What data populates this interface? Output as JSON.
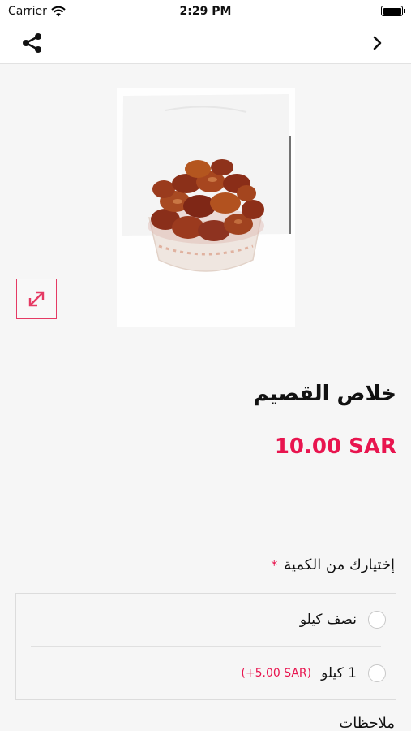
{
  "status_bar": {
    "carrier": "Carrier",
    "time": "2:29 PM"
  },
  "nav": {
    "share_icon": "share-icon",
    "back_icon": "chevron-right-icon"
  },
  "product": {
    "title": "خلاص القصيم",
    "price": "10.00 SAR",
    "zoom_icon": "expand-arrows-icon"
  },
  "options": {
    "label": "إختيارك من الكمية",
    "required_mark": "*",
    "items": [
      {
        "name": "نصف كيلو",
        "extra": ""
      },
      {
        "name": "1 كيلو",
        "extra": "(+5.00 SAR)"
      }
    ]
  },
  "notes": {
    "label": "ملاحظات"
  },
  "colors": {
    "accent": "#e8154f",
    "background": "#f6f6f6"
  }
}
